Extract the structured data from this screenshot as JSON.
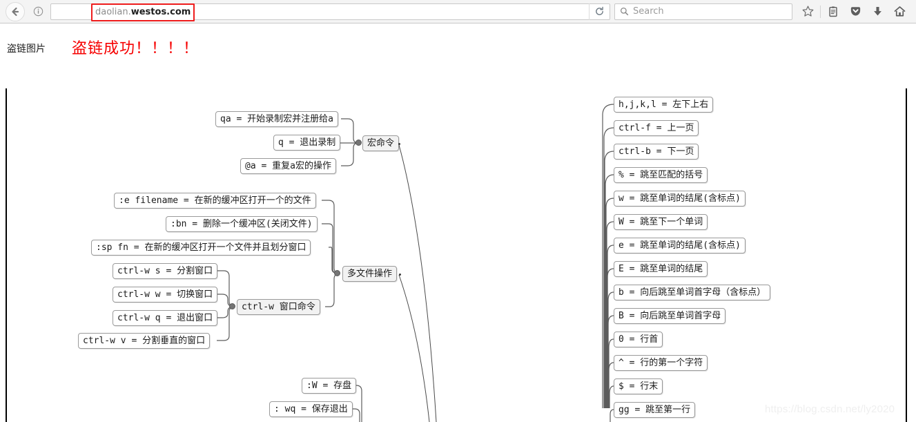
{
  "browser": {
    "back_label": "Back",
    "info_label": "Site information",
    "url_prefix": "daolian.",
    "url_domain": "westos.com",
    "url_full": "daolian.westos.com",
    "reload_label": "Reload",
    "search_placeholder": "Search",
    "icons": [
      "bookmark-star-icon",
      "library-icon",
      "pocket-icon",
      "downloads-icon",
      "home-icon"
    ]
  },
  "page": {
    "hotlink_label": "盗链图片",
    "hotlink_success": "盗链成功！！！！",
    "watermark": "https://blog.csdn.net/ly2020"
  },
  "mindmap": {
    "branches": {
      "macro": "宏命令",
      "multifile": "多文件操作",
      "window_cmd": "ctrl-w 窗口命令"
    },
    "macro_children": [
      "qa = 开始录制宏并注册给a",
      "q = 退出录制",
      "@a = 重复a宏的操作"
    ],
    "multifile_children": [
      ":e filename = 在新的缓冲区打开一个的文件",
      ":bn = 删除一个缓冲区(关闭文件)",
      ":sp fn = 在新的缓冲区打开一个文件并且划分窗口"
    ],
    "window_children": [
      "ctrl-w s = 分割窗口",
      "ctrl-w w = 切换窗口",
      "ctrl-w q = 退出窗口",
      "ctrl-w v = 分割垂直的窗口"
    ],
    "save_children": [
      ":W = 存盘",
      ": wq = 保存退出"
    ],
    "motion_children": [
      "h,j,k,l = 左下上右",
      "ctrl-f = 上一页",
      "ctrl-b = 下一页",
      "% = 跳至匹配的括号",
      "w = 跳至单词的结尾(含标点)",
      "W = 跳至下一个单词",
      "e = 跳至单词的结尾(含标点)",
      "E = 跳至单词的结尾",
      "b = 向后跳至单词首字母（含标点）",
      "B = 向后跳至单词首字母",
      "0 = 行首",
      "^ = 行的第一个字符",
      "$ = 行末",
      "gg = 跳至第一行"
    ]
  },
  "colors": {
    "hotlink_red": "#f60000",
    "url_highlight": "#ee1c1c",
    "node_border": "#9a9a9a",
    "branch_fill": "#f2f2f2"
  }
}
